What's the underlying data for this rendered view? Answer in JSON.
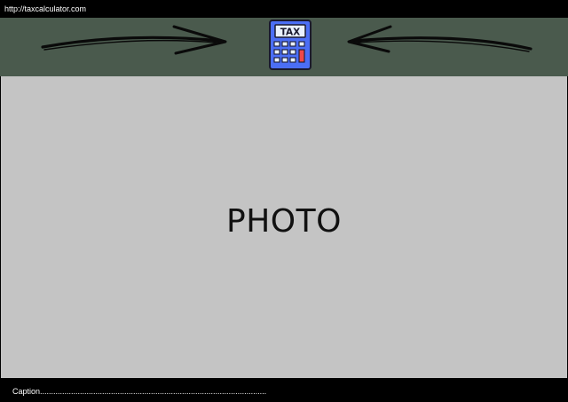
{
  "browser": {
    "url": "http://taxcalculator.com"
  },
  "banner": {
    "icon": "tax-calculator-icon",
    "icon_label": "TAX",
    "left_arrow_icon": "arrow-right-icon",
    "right_arrow_icon": "arrow-left-icon",
    "background_color": "#4a5a4d"
  },
  "main": {
    "placeholder_text": "PHOTO"
  },
  "footer": {
    "caption": "Caption......................................................................................................"
  }
}
